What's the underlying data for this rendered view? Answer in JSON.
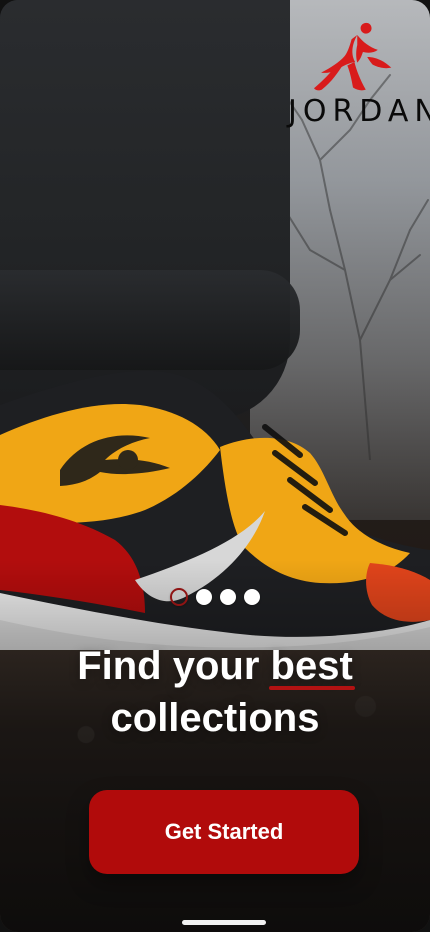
{
  "brand": {
    "name": "JORDAN",
    "logo_icon": "jumpman-icon"
  },
  "pagination": {
    "active_index": 0,
    "count": 4
  },
  "headline": {
    "prefix": "Find your",
    "highlight": "best",
    "line2": "collections"
  },
  "cta": {
    "label": "Get Started"
  },
  "colors": {
    "accent": "#b10b0b",
    "dot_active": "#8f1414",
    "text": "#ffffff",
    "logo": "#d81b1b",
    "wordmark": "#0a0a0a"
  }
}
